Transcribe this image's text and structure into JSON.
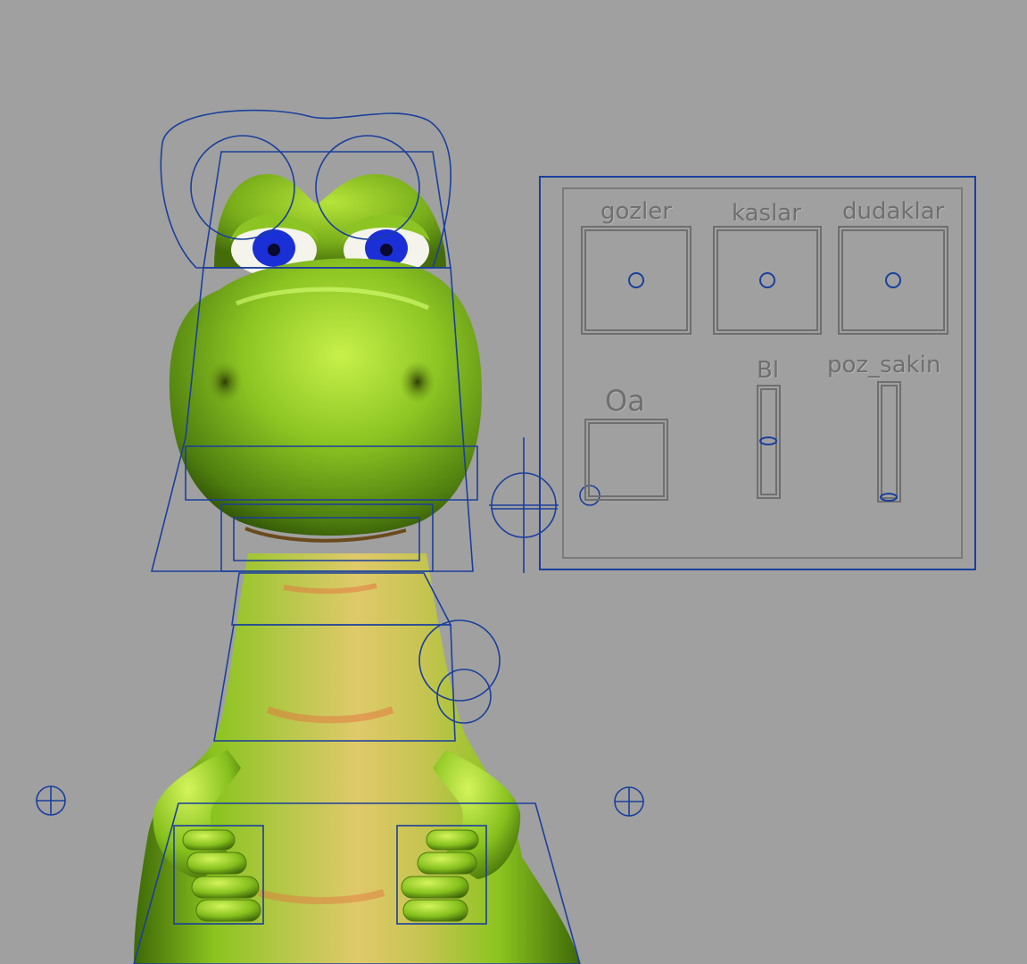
{
  "viewport": {
    "background": "#a0a0a0",
    "controller_color": "#1a3f9c",
    "panel_color": "#6f6f6f"
  },
  "face_panel": {
    "sections": [
      {
        "label": "gozler",
        "control": "gozler-control"
      },
      {
        "label": "kaslar",
        "control": "kaslar-control"
      },
      {
        "label": "dudaklar",
        "control": "dudaklar-control"
      }
    ],
    "oa_label": "Oa",
    "bl_label": "Bl",
    "poz_label": "poz_sakin"
  },
  "character": {
    "skin_color": "#7ab51e",
    "belly_color": "#d6c25a",
    "eye_color": "#1b2fd6"
  }
}
